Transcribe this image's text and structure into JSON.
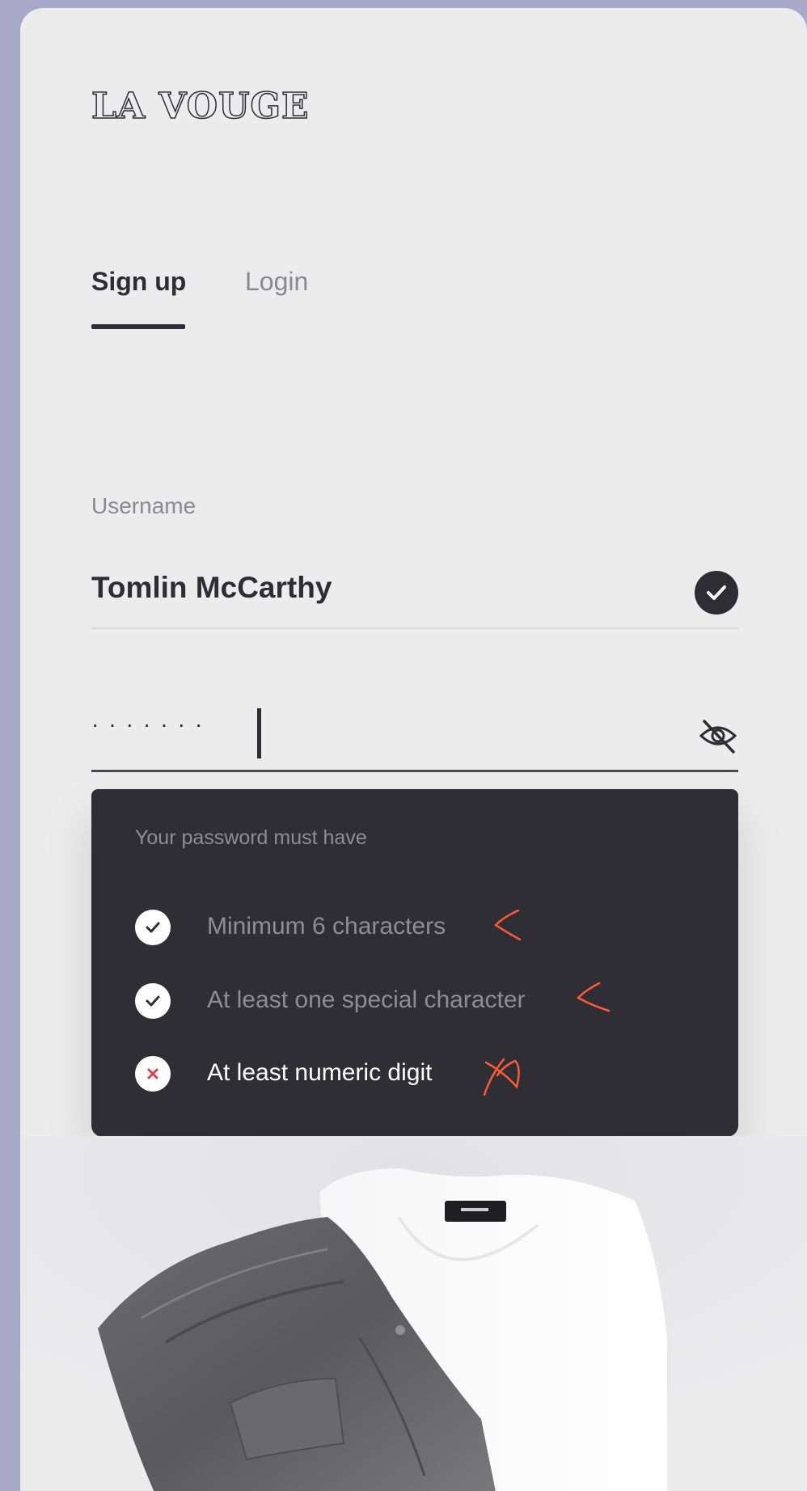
{
  "brand": {
    "logo": "LA VOUGE"
  },
  "tabs": [
    {
      "label": "Sign up",
      "active": true
    },
    {
      "label": "Login",
      "active": false
    }
  ],
  "form": {
    "username": {
      "label": "Username",
      "value": "Tomlin McCarthy",
      "valid_icon": "check-circle-icon"
    },
    "password": {
      "masked_value": "·······",
      "toggle_icon": "eye-off-icon"
    }
  },
  "password_rules": {
    "title": "Your password must have",
    "items": [
      {
        "label": "Minimum 6 characters",
        "status": "met",
        "icon": "check-icon"
      },
      {
        "label": "At least one special character",
        "status": "met",
        "icon": "check-icon"
      },
      {
        "label": "At least numeric digit",
        "status": "unmet",
        "icon": "x-icon"
      }
    ]
  },
  "colors": {
    "background": "#a9a8c9",
    "card": "#ececed",
    "dark": "#2f2e35",
    "error": "#e23d4a",
    "annotation": "#ff5a36"
  }
}
